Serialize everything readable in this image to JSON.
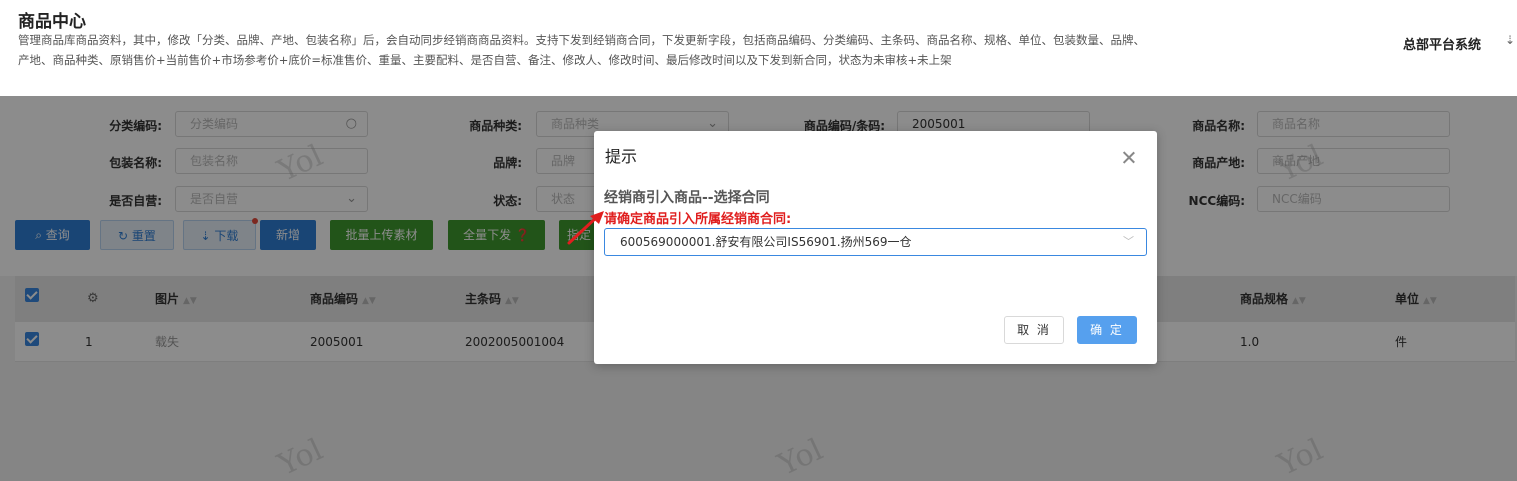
{
  "header": {
    "title": "商品中心",
    "description": "管理商品库商品资料，其中，修改「分类、品牌、产地、包装名称」后，会自动同步经销商商品资料。支持下发到经销商合同，下发更新字段，包括商品编码、分类编码、主条码、商品名称、规格、单位、包装数量、品牌、产地、商品种类、原销售价+当前售价+市场参考价+底价=标准售价、重量、主要配料、是否自营、备注、修改人、修改时间、最后修改时间以及下发到新合同，状态为未审核+未上架",
    "system_name": "总部平台系统",
    "system_arrow": "⇣"
  },
  "filters": {
    "category_code": {
      "label": "分类编码:",
      "placeholder": "分类编码"
    },
    "product_type": {
      "label": "商品种类:",
      "placeholder": "商品种类"
    },
    "product_code": {
      "label": "商品编码/条码:",
      "value": "2005001"
    },
    "product_name": {
      "label": "商品名称:",
      "placeholder": "商品名称"
    },
    "package_name": {
      "label": "包装名称:",
      "placeholder": "包装名称"
    },
    "brand": {
      "label": "品牌:",
      "placeholder": "品牌"
    },
    "origin": {
      "label": "商品产地:",
      "placeholder": "商品产地"
    },
    "self_operated": {
      "label": "是否自营:",
      "placeholder": "是否自营"
    },
    "status": {
      "label": "状态:",
      "placeholder": "状态"
    },
    "ncc_code": {
      "label": "NCC编码:",
      "placeholder": "NCC编码"
    }
  },
  "toolbar": {
    "query": "查询",
    "reset": "重置",
    "download": "下载",
    "add": "新增",
    "batch_upload": "批量上传素材",
    "push_all": "全量下发",
    "partial": "指定"
  },
  "table": {
    "columns": [
      "图片",
      "商品编码",
      "主条码",
      "商品规格",
      "单位"
    ],
    "rows": [
      {
        "index": "1",
        "image": "载失",
        "code": "2005001",
        "barcode": "2002005001004",
        "spec": "1.0",
        "unit": "件"
      }
    ]
  },
  "watermark": "Yol",
  "dialog": {
    "title": "提示",
    "subtitle": "经销商引入商品--选择合同",
    "hint": "请确定商品引入所属经销商合同:",
    "selected_contract": "600569000001.舒安有限公司IS56901.扬州569一仓",
    "cancel": "取 消",
    "ok": "确 定"
  },
  "colors": {
    "primary": "#2f7fd6",
    "success": "#3f9a2e",
    "hint_red": "#e01e1e"
  }
}
